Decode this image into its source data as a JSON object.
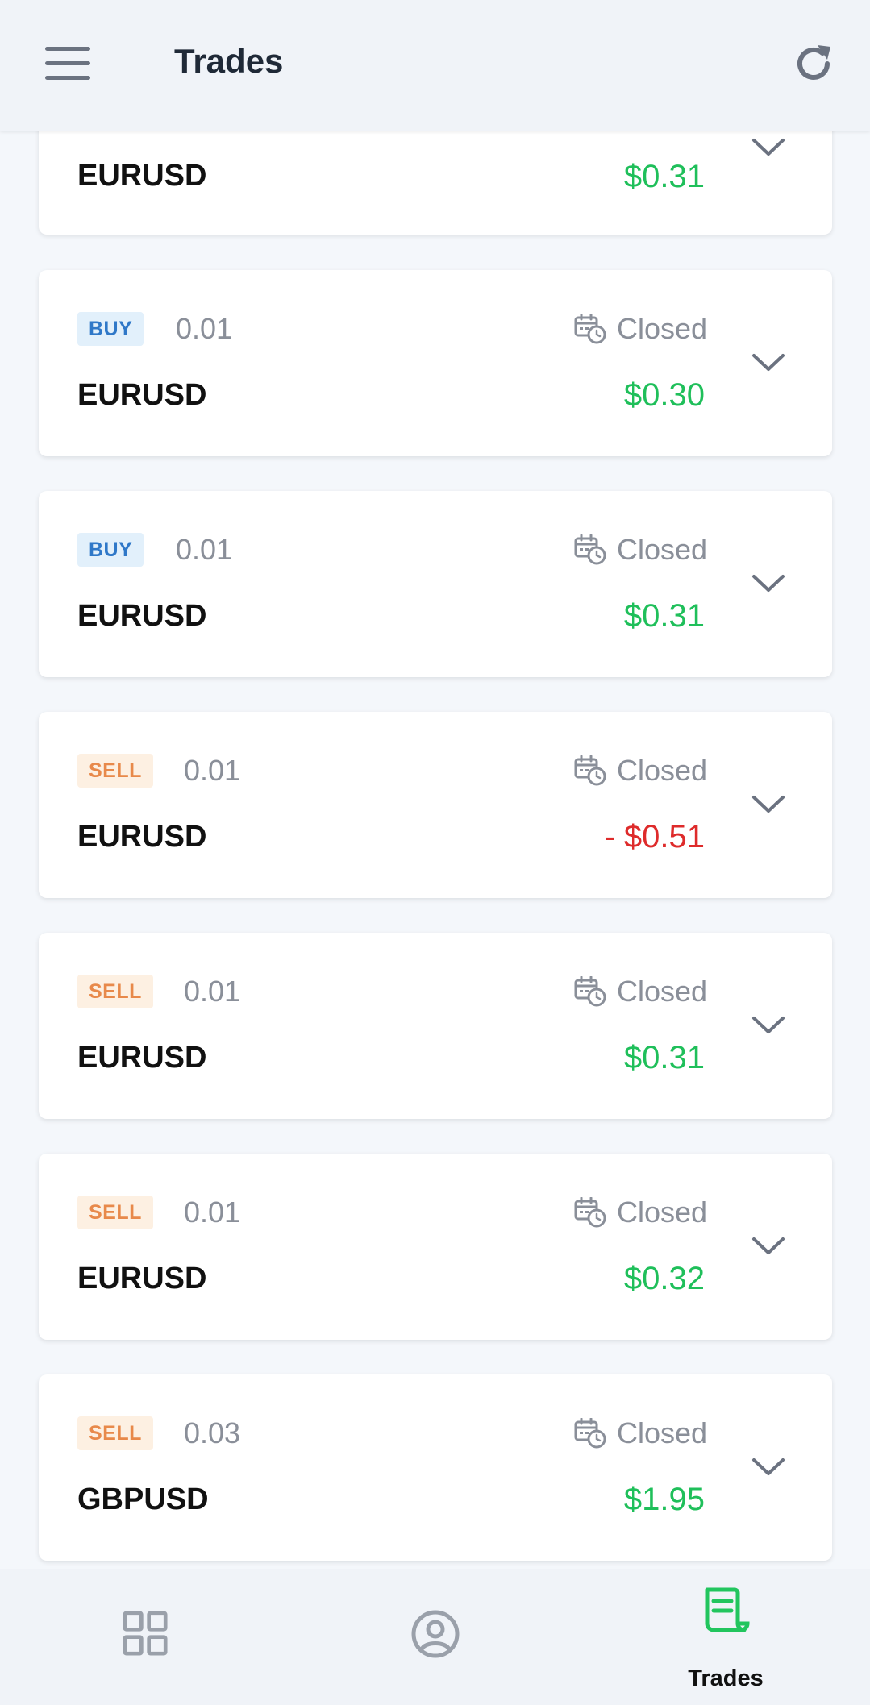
{
  "header": {
    "title": "Trades",
    "menu_icon": "hamburger-menu-icon",
    "refresh_icon": "refresh-icon"
  },
  "trades": [
    {
      "side": "",
      "volume": "",
      "status": "",
      "symbol": "EURUSD",
      "pnl": "$0.31",
      "pnl_sign": "positive"
    },
    {
      "side": "BUY",
      "volume": "0.01",
      "status": "Closed",
      "symbol": "EURUSD",
      "pnl": "$0.30",
      "pnl_sign": "positive"
    },
    {
      "side": "BUY",
      "volume": "0.01",
      "status": "Closed",
      "symbol": "EURUSD",
      "pnl": "$0.31",
      "pnl_sign": "positive"
    },
    {
      "side": "SELL",
      "volume": "0.01",
      "status": "Closed",
      "symbol": "EURUSD",
      "pnl": "- $0.51",
      "pnl_sign": "negative"
    },
    {
      "side": "SELL",
      "volume": "0.01",
      "status": "Closed",
      "symbol": "EURUSD",
      "pnl": "$0.31",
      "pnl_sign": "positive"
    },
    {
      "side": "SELL",
      "volume": "0.01",
      "status": "Closed",
      "symbol": "EURUSD",
      "pnl": "$0.32",
      "pnl_sign": "positive"
    },
    {
      "side": "SELL",
      "volume": "0.03",
      "status": "Closed",
      "symbol": "GBPUSD",
      "pnl": "$1.95",
      "pnl_sign": "positive"
    }
  ],
  "bottom_nav": {
    "items": [
      {
        "icon": "dashboard-grid-icon",
        "label": ""
      },
      {
        "icon": "account-user-icon",
        "label": ""
      },
      {
        "icon": "trades-receipt-icon",
        "label": "Trades",
        "active": true
      }
    ]
  },
  "colors": {
    "positive": "#1fbf5a",
    "negative": "#de2b2b",
    "buy_badge_text": "#2f78c8",
    "sell_badge_text": "#e8894a",
    "active_nav": "#22c55e",
    "inactive_nav": "#9aa0aa"
  }
}
